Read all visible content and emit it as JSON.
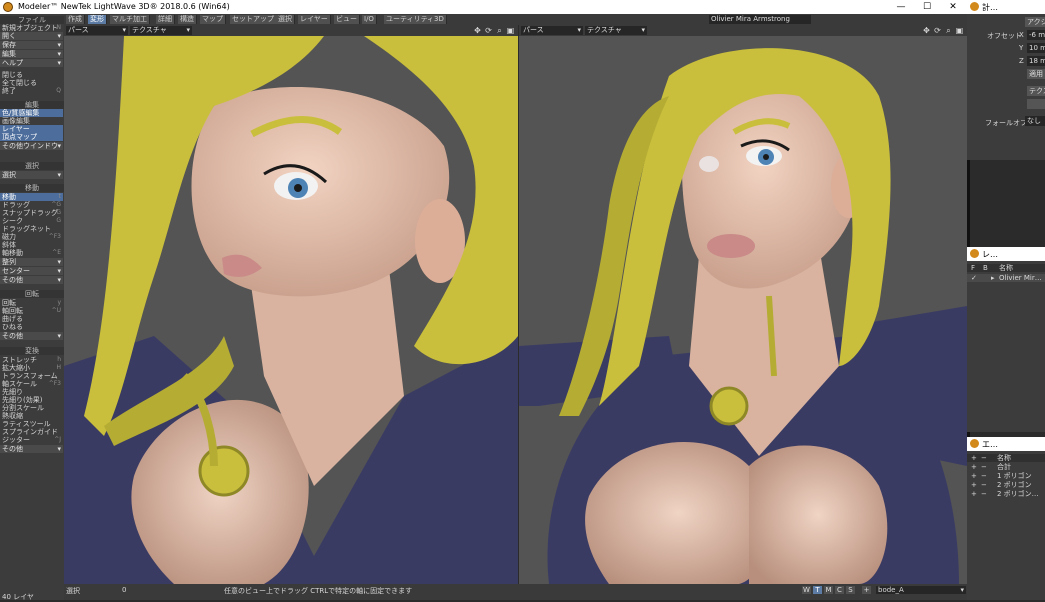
{
  "window": {
    "title": "Modeler™ NewTek LightWave 3D® 2018.0.6 (Win64)",
    "minimize": "—",
    "maximize": "☐",
    "close": "✕"
  },
  "tabs": [
    "作成",
    "変形",
    "マルチ加工",
    "詳細",
    "構造",
    "マップ",
    "セットアップ",
    "選択",
    "レイヤー",
    "ビュー",
    "I/O",
    "ユーティリティ",
    "3D"
  ],
  "active_tab": "変形",
  "scene_object": "Olivier Mira Armstrong",
  "left_panel": {
    "file": {
      "header": "ファイル",
      "items": [
        {
          "label": "新規オブジェクト",
          "shortcut": "N"
        },
        {
          "label": "開く",
          "shortcut": ""
        },
        {
          "label": "保存",
          "shortcut": ""
        },
        {
          "label": "編集",
          "shortcut": ""
        },
        {
          "label": "ヘルプ",
          "shortcut": ""
        },
        {
          "label": "閉じる",
          "shortcut": ""
        },
        {
          "label": "全て閉じる",
          "shortcut": ""
        },
        {
          "label": "終了",
          "shortcut": "Q"
        }
      ]
    },
    "edit": {
      "header": "編集",
      "items": [
        "色/質感編集",
        "画像編集",
        "レイヤー",
        "頂点マップ"
      ],
      "dropdown": "その他ウインドウ"
    },
    "select": {
      "header": "選択",
      "dropdown": "選択"
    },
    "move": {
      "header": "移動",
      "items": [
        {
          "label": "移動",
          "shortcut": "t"
        },
        {
          "label": "ドラッグ",
          "shortcut": "^G"
        },
        {
          "label": "スナップドラッグ",
          "shortcut": "^G"
        },
        {
          "label": "シーク",
          "shortcut": "G"
        },
        {
          "label": "ドラッグネット",
          "shortcut": ""
        },
        {
          "label": "磁力",
          "shortcut": "^F3"
        },
        {
          "label": "斜体",
          "shortcut": ""
        },
        {
          "label": "軸移動",
          "shortcut": "^E"
        },
        {
          "label": "整列",
          "shortcut": ""
        },
        {
          "label": "センター",
          "shortcut": ""
        }
      ],
      "dropdown": "その他"
    },
    "rotate": {
      "header": "回転",
      "items": [
        {
          "label": "回転",
          "shortcut": "y"
        },
        {
          "label": "軸回転",
          "shortcut": "^U"
        },
        {
          "label": "曲げる",
          "shortcut": ""
        },
        {
          "label": "ひねる",
          "shortcut": ""
        }
      ],
      "dropdown": "その他"
    },
    "transform": {
      "header": "変換",
      "items": [
        {
          "label": "ストレッチ",
          "shortcut": "h"
        },
        {
          "label": "拡大縮小",
          "shortcut": "H"
        },
        {
          "label": "トランスフォーム",
          "shortcut": ""
        },
        {
          "label": "軸スケール",
          "shortcut": "^F3"
        },
        {
          "label": "先細り",
          "shortcut": ""
        },
        {
          "label": "先細り(効果)",
          "shortcut": ""
        },
        {
          "label": "分割スケール",
          "shortcut": ""
        },
        {
          "label": "熱収縮",
          "shortcut": ""
        },
        {
          "label": "ラティスツール",
          "shortcut": ""
        },
        {
          "label": "スプラインガイド",
          "shortcut": ""
        },
        {
          "label": "ジッター",
          "shortcut": "^J"
        }
      ],
      "dropdown": "その他"
    }
  },
  "viewports": [
    {
      "projection": "パース",
      "shading": "テクスチャ"
    },
    {
      "projection": "パース",
      "shading": "テクスチャ"
    }
  ],
  "viewport_icons": [
    "move-icon",
    "rotate-icon",
    "zoom-icon",
    "maximize-icon"
  ],
  "status": {
    "select_label": "選択",
    "select_count": "0",
    "hint": "任意のビュー上でドラッグ CTRLで特定の軸に固定できます",
    "layer_count": "40 レイヤ",
    "wt_buttons": [
      "W",
      "T",
      "M",
      "C",
      "S"
    ],
    "wt_active": "T",
    "plus": "+",
    "layer_name": "bode_A"
  },
  "right_panels": {
    "properties": {
      "title": "計…",
      "tab": "アクシ",
      "offset_label": "オフセット",
      "axes": [
        {
          "axis": "X",
          "value": "-6 m"
        },
        {
          "axis": "Y",
          "value": "10 m"
        },
        {
          "axis": "Z",
          "value": "18 m"
        }
      ],
      "apply": "適用",
      "texture": "テクス",
      "falloff_label": "フォールオフ",
      "falloff_value": "なし"
    },
    "layers": {
      "title": "レ…",
      "col_f": "F",
      "col_b": "B",
      "col_name": "名称",
      "rows": [
        "Olivier Mir…"
      ]
    },
    "stats": {
      "title": "エ…",
      "col_name": "名称",
      "rows": [
        "合計",
        "1 ポリゴン",
        "2 ポリゴン",
        "2 ポリゴン…"
      ]
    }
  },
  "colors": {
    "viewport_bg": "#545454",
    "panel_bg": "#3c3c3c",
    "highlight": "#4d6e9c",
    "hair": "#c9bf3c",
    "skin": "#e7c0ad",
    "jacket": "#3c3c64"
  }
}
